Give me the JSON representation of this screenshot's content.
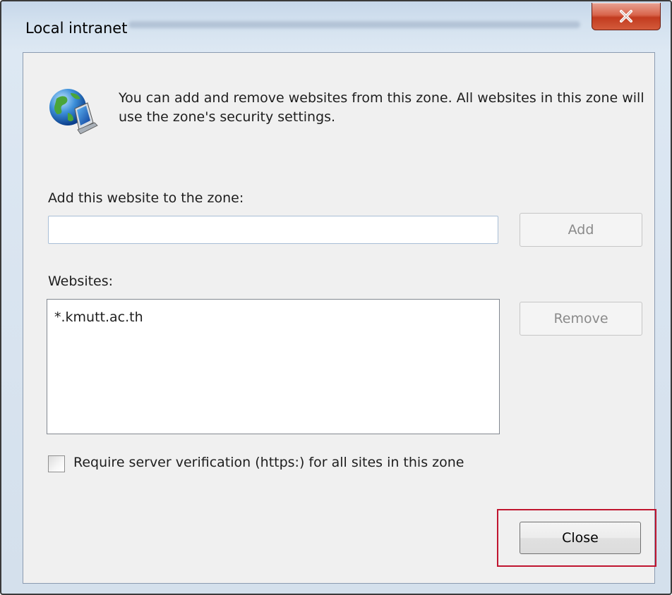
{
  "window": {
    "title": "Local intranet",
    "close_glyph": "✕"
  },
  "info": {
    "icon": "globe-computer-icon",
    "text": "You can add and remove websites from this zone. All websites in this zone will use the zone's security settings."
  },
  "add_section": {
    "label": "Add this website to the zone:",
    "input_value": "",
    "add_button": "Add"
  },
  "websites": {
    "label": "Websites:",
    "items": [
      "*.kmutt.ac.th"
    ],
    "remove_button": "Remove"
  },
  "require_https": {
    "label": "Require server verification (https:) for all sites in this zone",
    "checked": false
  },
  "footer": {
    "close_button": "Close"
  },
  "colors": {
    "highlight": "#c0152f",
    "close_x_bg": "#c94f33"
  }
}
